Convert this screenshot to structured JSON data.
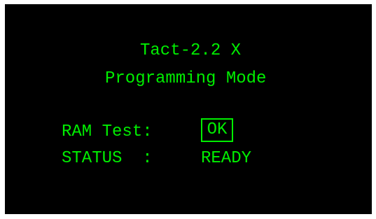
{
  "screen": {
    "title": "Tact-2.2 X",
    "subtitle": "Programming Mode",
    "ram_test": {
      "label": "RAM Test:",
      "value": "OK"
    },
    "status": {
      "label": "STATUS  :",
      "value": "READY"
    },
    "colors": {
      "background": "#000000",
      "text": "#00ee00",
      "frame": "#ffffff"
    }
  }
}
